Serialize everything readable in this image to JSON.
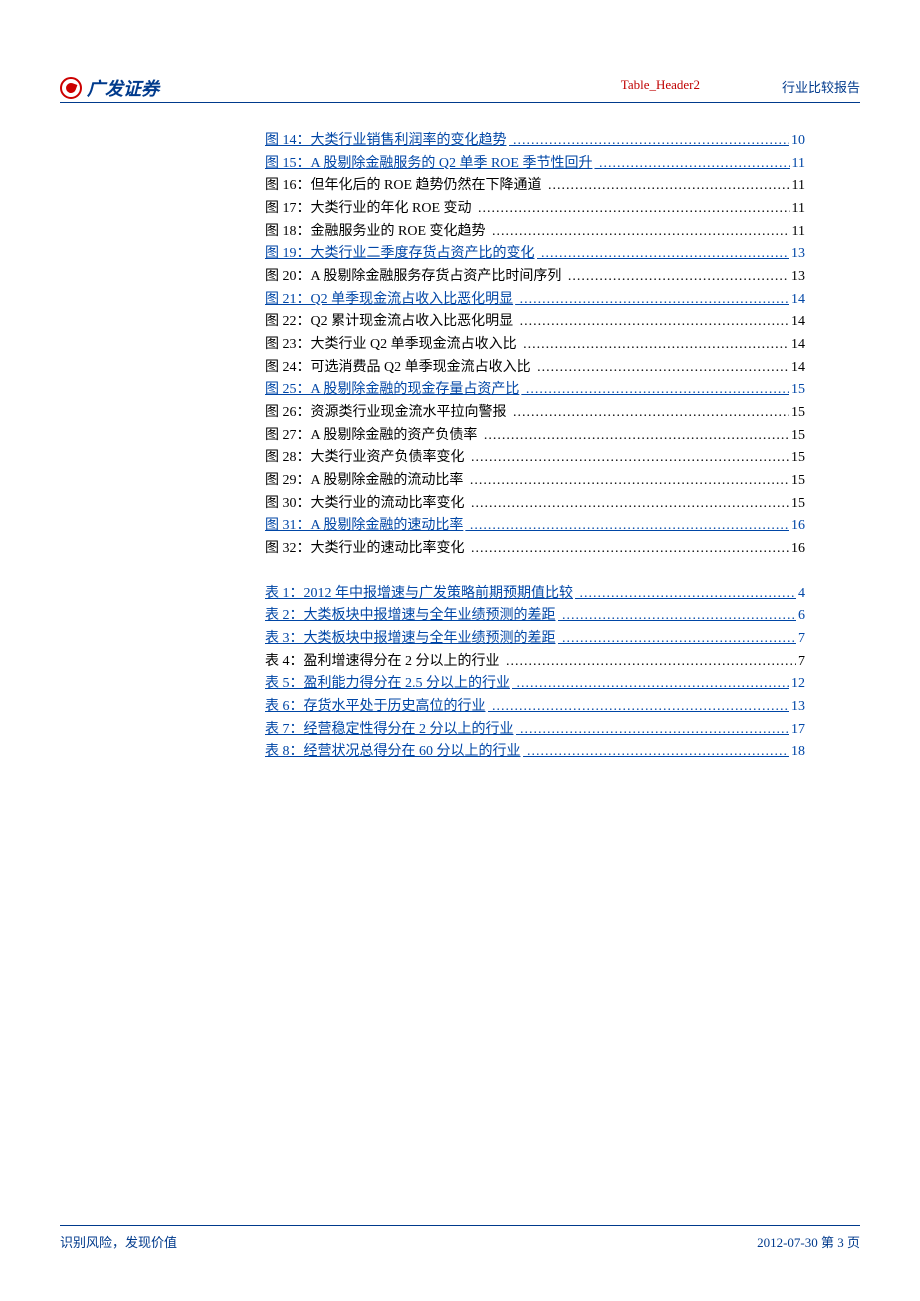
{
  "header": {
    "logo_text": "广发证券",
    "mid_text": "Table_Header2",
    "right_text": "行业比较报告"
  },
  "toc_figures": [
    {
      "label": "图 14：大类行业销售利润率的变化趋势",
      "page": "10",
      "link": true
    },
    {
      "label": "图 15：A 股剔除金融服务的 Q2 单季 ROE 季节性回升",
      "page": "11",
      "link": true
    },
    {
      "label": "图 16：但年化后的 ROE 趋势仍然在下降通道",
      "page": "11",
      "link": false
    },
    {
      "label": "图 17：大类行业的年化 ROE 变动",
      "page": "11",
      "link": false
    },
    {
      "label": "图 18：金融服务业的 ROE 变化趋势",
      "page": "11",
      "link": false
    },
    {
      "label": "图 19：大类行业二季度存货占资产比的变化",
      "page": "13",
      "link": true
    },
    {
      "label": "图 20：A 股剔除金融服务存货占资产比时间序列",
      "page": "13",
      "link": false
    },
    {
      "label": "图 21：Q2 单季现金流占收入比恶化明显",
      "page": "14",
      "link": true
    },
    {
      "label": "图 22：Q2 累计现金流占收入比恶化明显",
      "page": "14",
      "link": false
    },
    {
      "label": "图 23：大类行业 Q2 单季现金流占收入比",
      "page": "14",
      "link": false
    },
    {
      "label": "图 24：可选消费品 Q2 单季现金流占收入比",
      "page": "14",
      "link": false
    },
    {
      "label": "图 25：A 股剔除金融的现金存量占资产比",
      "page": "15",
      "link": true
    },
    {
      "label": "图 26：资源类行业现金流水平拉向警报",
      "page": "15",
      "link": false
    },
    {
      "label": "图 27：A 股剔除金融的资产负债率",
      "page": "15",
      "link": false
    },
    {
      "label": "图 28：大类行业资产负债率变化",
      "page": "15",
      "link": false
    },
    {
      "label": "图 29：A 股剔除金融的流动比率",
      "page": "15",
      "link": false
    },
    {
      "label": "图 30：大类行业的流动比率变化",
      "page": "15",
      "link": false
    },
    {
      "label": "图 31：A 股剔除金融的速动比率",
      "page": "16",
      "link": true
    },
    {
      "label": "图 32：大类行业的速动比率变化",
      "page": "16",
      "link": false
    }
  ],
  "toc_tables": [
    {
      "label": "表 1：2012 年中报增速与广发策略前期预期值比较",
      "page": "4",
      "link": true
    },
    {
      "label": "表 2：大类板块中报增速与全年业绩预测的差距",
      "page": "6",
      "link": true
    },
    {
      "label": "表 3：大类板块中报增速与全年业绩预测的差距",
      "page": "7",
      "link": true
    },
    {
      "label": "表 4：盈利增速得分在 2 分以上的行业",
      "page": "7",
      "link": false
    },
    {
      "label": "表 5：盈利能力得分在 2.5 分以上的行业",
      "page": "12",
      "link": true
    },
    {
      "label": "表 6：存货水平处于历史高位的行业",
      "page": "13",
      "link": true
    },
    {
      "label": "表 7：经营稳定性得分在 2 分以上的行业",
      "page": "17",
      "link": true
    },
    {
      "label": "表 8：经营状况总得分在 60 分以上的行业",
      "page": "18",
      "link": true
    }
  ],
  "footer": {
    "left": "识别风险，发现价值",
    "right": "2012-07-30  第 3 页"
  }
}
